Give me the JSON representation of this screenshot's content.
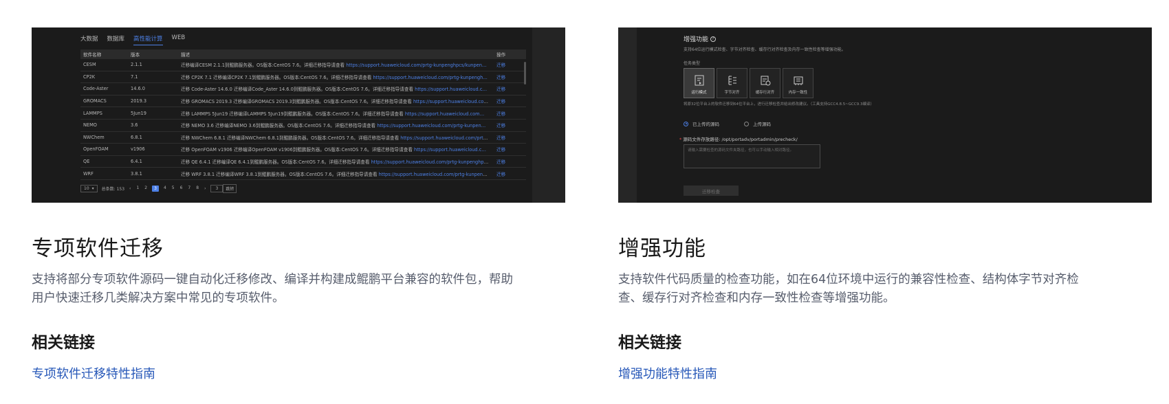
{
  "left": {
    "heading": "专项软件迁移",
    "description": "支持将部分专项软件源码一键自动化迁移修改、编译并构建成鲲鹏平台兼容的软件包，帮助用户快速迁移几类解决方案中常见的专项软件。",
    "related_title": "相关链接",
    "link_label": "专项软件迁移特性指南",
    "screenshot": {
      "tabs": [
        {
          "label": "大数据",
          "active": false
        },
        {
          "label": "数据库",
          "active": false
        },
        {
          "label": "高性能计算",
          "active": true
        },
        {
          "label": "WEB",
          "active": false
        }
      ],
      "columns": [
        "软件名称",
        "版本",
        "描述",
        "操作"
      ],
      "rows": [
        {
          "name": "CESM",
          "version": "2.1.1",
          "desc": "迁移编译CESM 2.1.1到鲲鹏服务器。OS版本:CentOS 7.6。详细迁移指导请查看 ",
          "url": "https://support.huaweicloud.com/prtg-kunpenghpcs/kunpen…",
          "op": "迁移"
        },
        {
          "name": "CP2K",
          "version": "7.1",
          "desc": "迁移 CP2K 7.1 迁移编译CP2K 7.1到鲲鹏服务器。OS版本:CentOS 7.6。详细迁移指导请查看 ",
          "url": "https://support.huaweicloud.com/prtg-kunpengh…",
          "op": "迁移"
        },
        {
          "name": "Code-Aster",
          "version": "14.6.0",
          "desc": "迁移 Code-Aster 14.6.0 迁移编译Code_Aster 14.6.0到鲲鹏服务器。OS版本:CentOS 7.6。详细迁移指导请查看 ",
          "url": "https://support.huaweicloud.c…",
          "op": "迁移"
        },
        {
          "name": "GROMACS",
          "version": "2019.3",
          "desc": "迁移 GROMACS 2019.3 迁移编译GROMACS 2019.3到鲲鹏服务器。OS版本:CentOS 7.6。详细迁移指导请查看 ",
          "url": "https://support.huaweicloud.com…",
          "op": "迁移"
        },
        {
          "name": "LAMMPS",
          "version": "5Jun19",
          "desc": "迁移 LAMMPS 5Jun19 迁移编译LAMMPS 5Jun19到鲲鹏服务器。OS版本:CentOS 7.6。详细迁移指导请查看 ",
          "url": "https://support.huaweicloud.com…",
          "op": "迁移"
        },
        {
          "name": "NEMO",
          "version": "3.6",
          "desc": "迁移 NEMO 3.6 迁移编译NEMO 3.6到鲲鹏服务器。OS版本:CentOS 7.6。详细迁移指导请查看 ",
          "url": "https://support.huaweicloud.com/prtg-kunpen…",
          "op": "迁移"
        },
        {
          "name": "NWChem",
          "version": "6.8.1",
          "desc": "迁移 NWChem 6.8.1 迁移编译NWChem 6.8.1到鲲鹏服务器。OS版本:CentOS 7.6。详细迁移指导请查看 ",
          "url": "https://support.huaweicloud.com/prtg-…",
          "op": "迁移"
        },
        {
          "name": "OpenFOAM",
          "version": "v1906",
          "desc": "迁移 OpenFOAM v1906 迁移编译OpenFOAM v1906到鲲鹏服务器。OS版本:CentOS 7.6。详细迁移指导请查看 ",
          "url": "https://support.huaweicloud.c…",
          "op": "迁移"
        },
        {
          "name": "QE",
          "version": "6.4.1",
          "desc": "迁移 QE 6.4.1 迁移编译QE 6.4.1到鲲鹏服务器。OS版本:CentOS 7.6。详细迁移指导请查看 ",
          "url": "https://support.huaweicloud.com/prtg-kunpenghpc…",
          "op": "迁移"
        },
        {
          "name": "WRF",
          "version": "3.8.1",
          "desc": "迁移 WRF 3.8.1 迁移编译WRF 3.8.1到鲲鹏服务器。OS版本:CentOS 7.6。详细迁移指导请查看 ",
          "url": "https://support.huaweicloud.com/prtg-kunpeng-…",
          "op": "迁移"
        }
      ],
      "pager": {
        "page_size": "10",
        "total": "总条数: 153",
        "prev": "‹",
        "next": "›",
        "pages": [
          "1",
          "2",
          "3",
          "4",
          "5",
          "6",
          "7",
          "8"
        ],
        "active_page": "3",
        "jump_value": "3",
        "jump_label": "跳转"
      }
    }
  },
  "right": {
    "heading": "增强功能",
    "description": "支持软件代码质量的检查功能，如在64位环境中运行的兼容性检查、结构体字节对齐检查、缓存行对齐检查和内存一致性检查等增强功能。",
    "related_title": "相关链接",
    "link_label": "增强功能特性指南",
    "screenshot": {
      "title": "增强功能",
      "subtitle": "支持64位运行模式检查、字节对齐检查、缓存行对齐检查及内存一致性检查等增强功能。",
      "task_type_label": "任务类型",
      "task_types": [
        {
          "label": "运行模式",
          "icon": "run-mode-icon",
          "active": true
        },
        {
          "label": "字节对齐",
          "icon": "byte-align-icon",
          "active": false
        },
        {
          "label": "缓存行对齐",
          "icon": "cache-align-icon",
          "active": false
        },
        {
          "label": "内存一致性",
          "icon": "memory-consistency-icon",
          "active": false
        }
      ],
      "note": "将原32位平台上的软件迁移到64位平台上，进行迁移检查并给出修改建议。（工具支持GCC4.8.5~GCC9.3编译）",
      "radio_options": [
        {
          "label": "已上传的源码",
          "selected": true
        },
        {
          "label": "上传源码",
          "selected": false
        }
      ],
      "path_label": "源码文件存放路径: /opt/portadv/portadmin/precheck/",
      "textarea_placeholder": "请输入需要检查的源码文件夹路径，也可以手动输入相对路径。",
      "button_label": "迁移检查"
    }
  }
}
